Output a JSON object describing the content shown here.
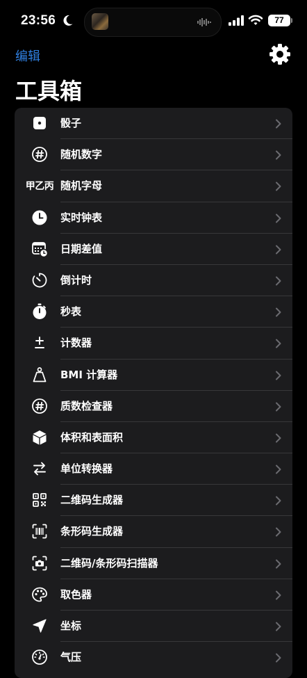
{
  "status_bar": {
    "time": "23:56",
    "battery": "77"
  },
  "nav": {
    "edit_label": "编辑",
    "settings_icon": "gear-icon"
  },
  "page_title": "工具箱",
  "colors": {
    "accent": "#2f7fe0",
    "list_background": "#1c1c1e",
    "separator": "#38383a"
  },
  "tools": [
    {
      "label": "骰子",
      "icon": "dice-icon"
    },
    {
      "label": "随机数字",
      "icon": "number-sign-icon"
    },
    {
      "label": "随机字母",
      "icon": "text-icon",
      "icon_text": "甲乙丙"
    },
    {
      "label": "实时钟表",
      "icon": "clock-icon"
    },
    {
      "label": "日期差值",
      "icon": "calendar-clock-icon"
    },
    {
      "label": "倒计时",
      "icon": "timer-icon"
    },
    {
      "label": "秒表",
      "icon": "stopwatch-icon"
    },
    {
      "label": "计数器",
      "icon": "plus-minus-icon"
    },
    {
      "label": "BMI 计算器",
      "icon": "scale-icon"
    },
    {
      "label": "质数检查器",
      "icon": "number-sign-icon"
    },
    {
      "label": "体积和表面积",
      "icon": "cube-icon"
    },
    {
      "label": "单位转换器",
      "icon": "arrows-swap-icon"
    },
    {
      "label": "二维码生成器",
      "icon": "qr-code-icon"
    },
    {
      "label": "条形码生成器",
      "icon": "barcode-icon"
    },
    {
      "label": "二维码/条形码扫描器",
      "icon": "camera-scan-icon"
    },
    {
      "label": "取色器",
      "icon": "palette-icon"
    },
    {
      "label": "坐标",
      "icon": "location-icon"
    },
    {
      "label": "气压",
      "icon": "gauge-icon"
    }
  ]
}
